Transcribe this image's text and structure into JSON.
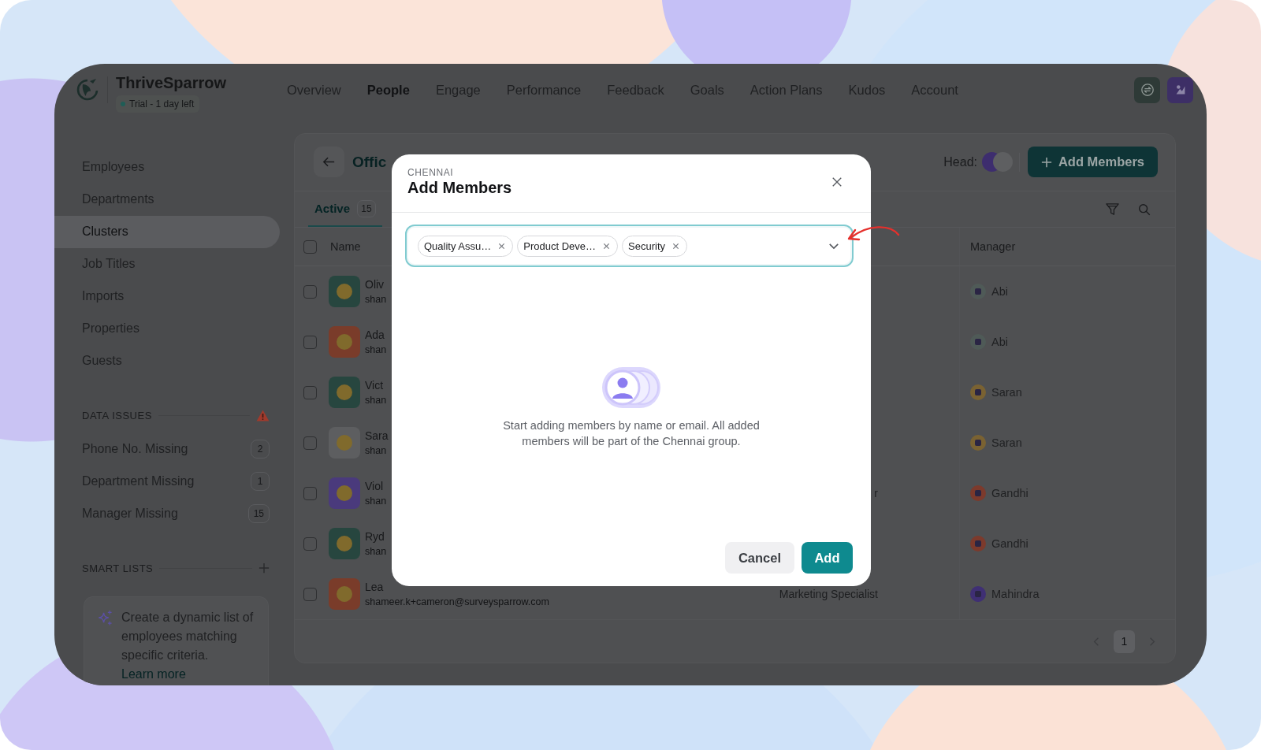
{
  "app": {
    "brand": "ThriveSparrow",
    "trial": "Trial - 1 day left"
  },
  "nav": [
    {
      "label": "Overview",
      "selected": false
    },
    {
      "label": "People",
      "selected": true
    },
    {
      "label": "Engage",
      "selected": false
    },
    {
      "label": "Performance",
      "selected": false
    },
    {
      "label": "Feedback",
      "selected": false
    },
    {
      "label": "Goals",
      "selected": false
    },
    {
      "label": "Action Plans",
      "selected": false
    },
    {
      "label": "Kudos",
      "selected": false
    },
    {
      "label": "Account",
      "selected": false
    }
  ],
  "sidebar": {
    "items": [
      {
        "label": "Employees",
        "selected": false
      },
      {
        "label": "Departments",
        "selected": false
      },
      {
        "label": "Clusters",
        "selected": true
      },
      {
        "label": "Job Titles",
        "selected": false
      },
      {
        "label": "Imports",
        "selected": false
      },
      {
        "label": "Properties",
        "selected": false
      },
      {
        "label": "Guests",
        "selected": false
      }
    ],
    "data_issues": {
      "title": "DATA ISSUES",
      "items": [
        {
          "label": "Phone No. Missing",
          "count": "2"
        },
        {
          "label": "Department Missing",
          "count": "1"
        },
        {
          "label": "Manager Missing",
          "count": "15"
        }
      ]
    },
    "smart_lists": {
      "title": "SMART LISTS",
      "tip": "Create a dynamic list of employees matching specific criteria.",
      "link": "Learn more"
    }
  },
  "page": {
    "title": "Offic",
    "head_label": "Head:",
    "head_avatars": [
      {
        "color": "#3d2d6e"
      },
      {
        "color": "#5e5f61"
      }
    ],
    "add_button": "Add Members",
    "tabs": [
      {
        "label": "Active",
        "count": "15",
        "selected": true
      }
    ],
    "table": {
      "header_checked": false,
      "columns": [
        "Name",
        "Manager"
      ],
      "rows": [
        {
          "checked": false,
          "name": "Oliv",
          "email": "shan",
          "color": "#27463f",
          "manager": {
            "name": "Abi",
            "color": "#4f5a57"
          }
        },
        {
          "checked": false,
          "name": "Ada",
          "email": "shan",
          "color": "#7a3c2a",
          "manager": {
            "name": "Abi",
            "color": "#4f5a57"
          }
        },
        {
          "checked": false,
          "name": "Vict",
          "email": "shan",
          "color": "#27463f",
          "manager": {
            "name": "Saran",
            "color": "#7a6232"
          }
        },
        {
          "checked": false,
          "name": "Sara",
          "email": "shan",
          "color": "#5d5e60",
          "manager": {
            "name": "Saran",
            "color": "#7a6232"
          }
        },
        {
          "checked": false,
          "name": "Viol",
          "email": "shan",
          "color": "#4a3a7c",
          "job_title": "r",
          "manager": {
            "name": "Gandhi",
            "color": "#7c3a2c"
          }
        },
        {
          "checked": false,
          "name": "Ryd",
          "email": "shan",
          "color": "#27463f",
          "manager": {
            "name": "Gandhi",
            "color": "#7c3a2c"
          }
        },
        {
          "checked": false,
          "name": "Lea",
          "email": "shameer.k+cameron@surveysparrow.com",
          "color": "#7a3c2a",
          "job_title": "Marketing Specialist",
          "manager": {
            "name": "Mahindra",
            "color": "#3f2f74"
          }
        }
      ]
    },
    "pagination": [
      {
        "label": "1",
        "selected": true
      }
    ]
  },
  "modal": {
    "eyebrow": "CHENNAI",
    "title": "Add Members",
    "chips": [
      "Quality Assu…",
      "Product Deve…",
      "Security"
    ],
    "message": "Start adding members by name or email. All added members will be part of the Chennai group.",
    "buttons": [
      {
        "label": "Cancel",
        "kind": "secondary"
      },
      {
        "label": "Add",
        "kind": "primary"
      }
    ]
  }
}
